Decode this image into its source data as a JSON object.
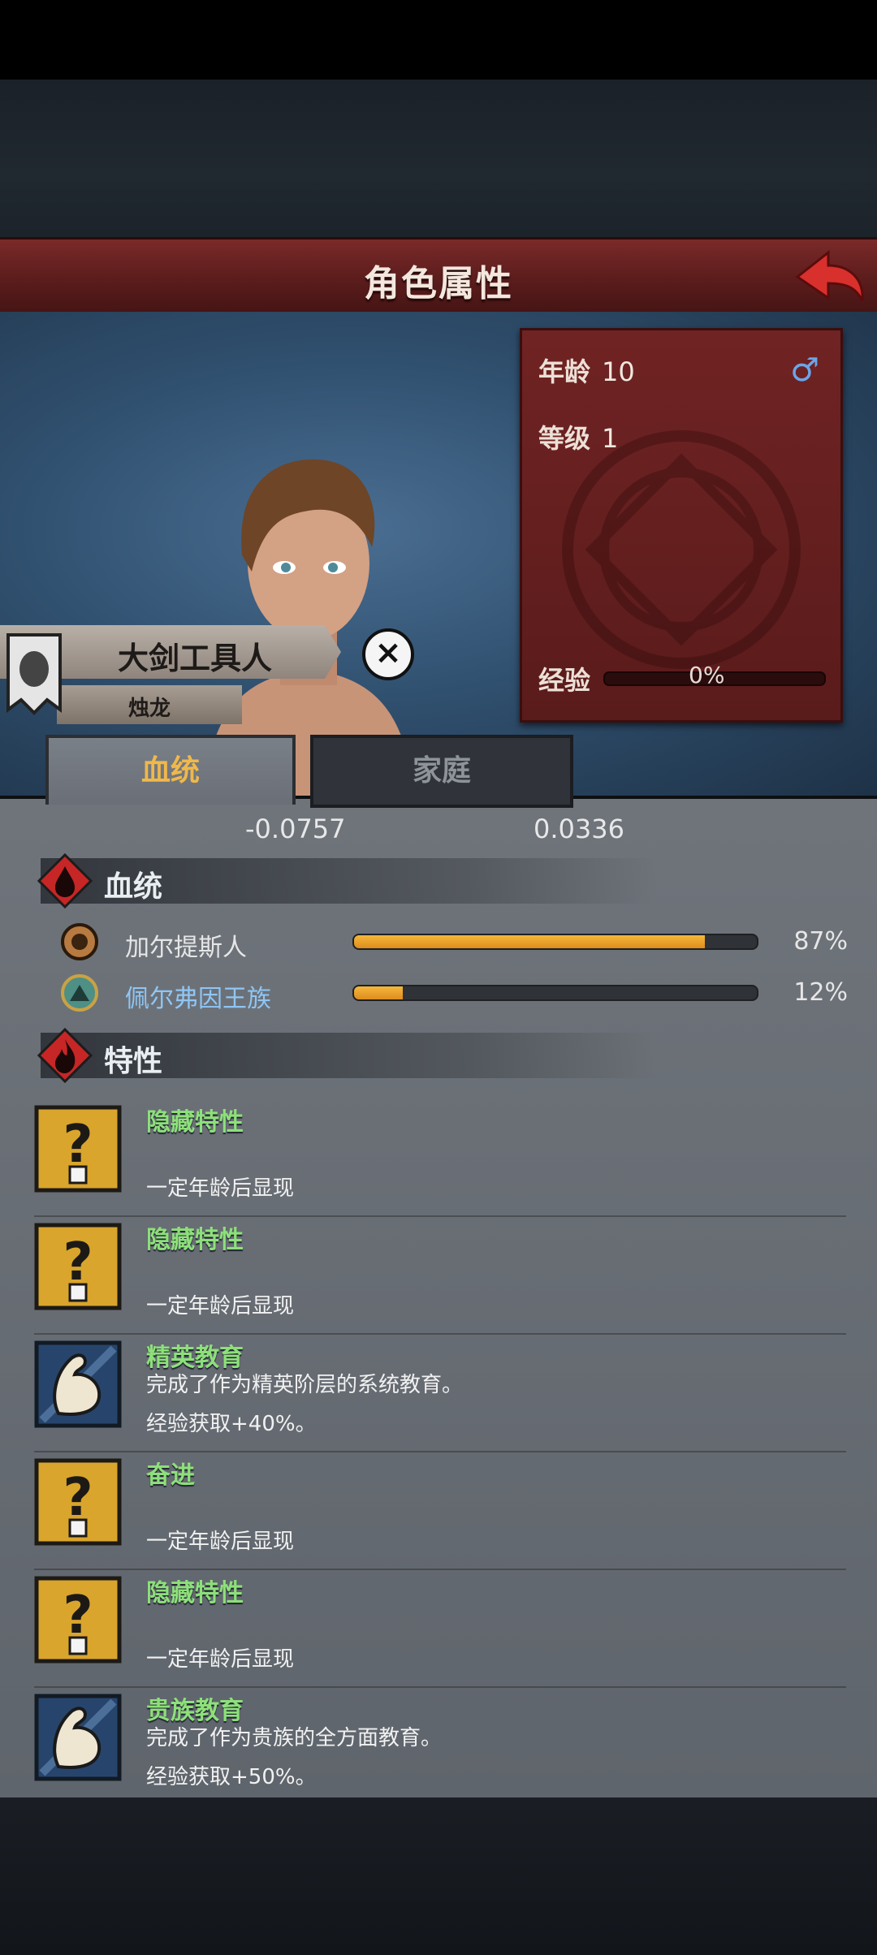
{
  "header": {
    "title": "角色属性"
  },
  "profile": {
    "age_label": "年龄",
    "age_value": "10",
    "level_label": "等级",
    "level_value": "1",
    "exp_label": "经验",
    "exp_value": "0%",
    "gender_symbol": "♂",
    "name": "大剑工具人",
    "house": "烛龙"
  },
  "tabs": [
    {
      "label": "血统",
      "active": true
    },
    {
      "label": "家庭",
      "active": false
    }
  ],
  "stats": {
    "left_value": "-0.0757",
    "right_value": "0.0336"
  },
  "bloodline_section": {
    "title": "血统",
    "items": [
      {
        "name": "加尔提斯人",
        "percent": "87%",
        "fraction": 0.87,
        "name_color": "#e6e6e6"
      },
      {
        "name": "佩尔弗因王族",
        "percent": "12%",
        "fraction": 0.12,
        "name_color": "#8fc6f4"
      }
    ]
  },
  "traits_section": {
    "title": "特性",
    "items": [
      {
        "name": "隐藏特性",
        "desc_line1": "",
        "desc_line2": "一定年龄后显现",
        "icon": "question-icon"
      },
      {
        "name": "隐藏特性",
        "desc_line1": "",
        "desc_line2": "一定年龄后显现",
        "icon": "question-icon"
      },
      {
        "name": "精英教育",
        "desc_line1": "完成了作为精英阶层的系统教育。",
        "desc_line2": "经验获取+40%。",
        "icon": "muscle-arm-icon"
      },
      {
        "name": "奋进",
        "desc_line1": "",
        "desc_line2": "一定年龄后显现",
        "icon": "question-icon"
      },
      {
        "name": "隐藏特性",
        "desc_line1": "",
        "desc_line2": "一定年龄后显现",
        "icon": "question-icon"
      },
      {
        "name": "贵族教育",
        "desc_line1": "完成了作为贵族的全方面教育。",
        "desc_line2": "经验获取+50%。",
        "icon": "muscle-arm-icon"
      }
    ]
  },
  "colors": {
    "accent": "#f0b84a",
    "trait_name": "#8de07a",
    "header": "#6b2424"
  }
}
